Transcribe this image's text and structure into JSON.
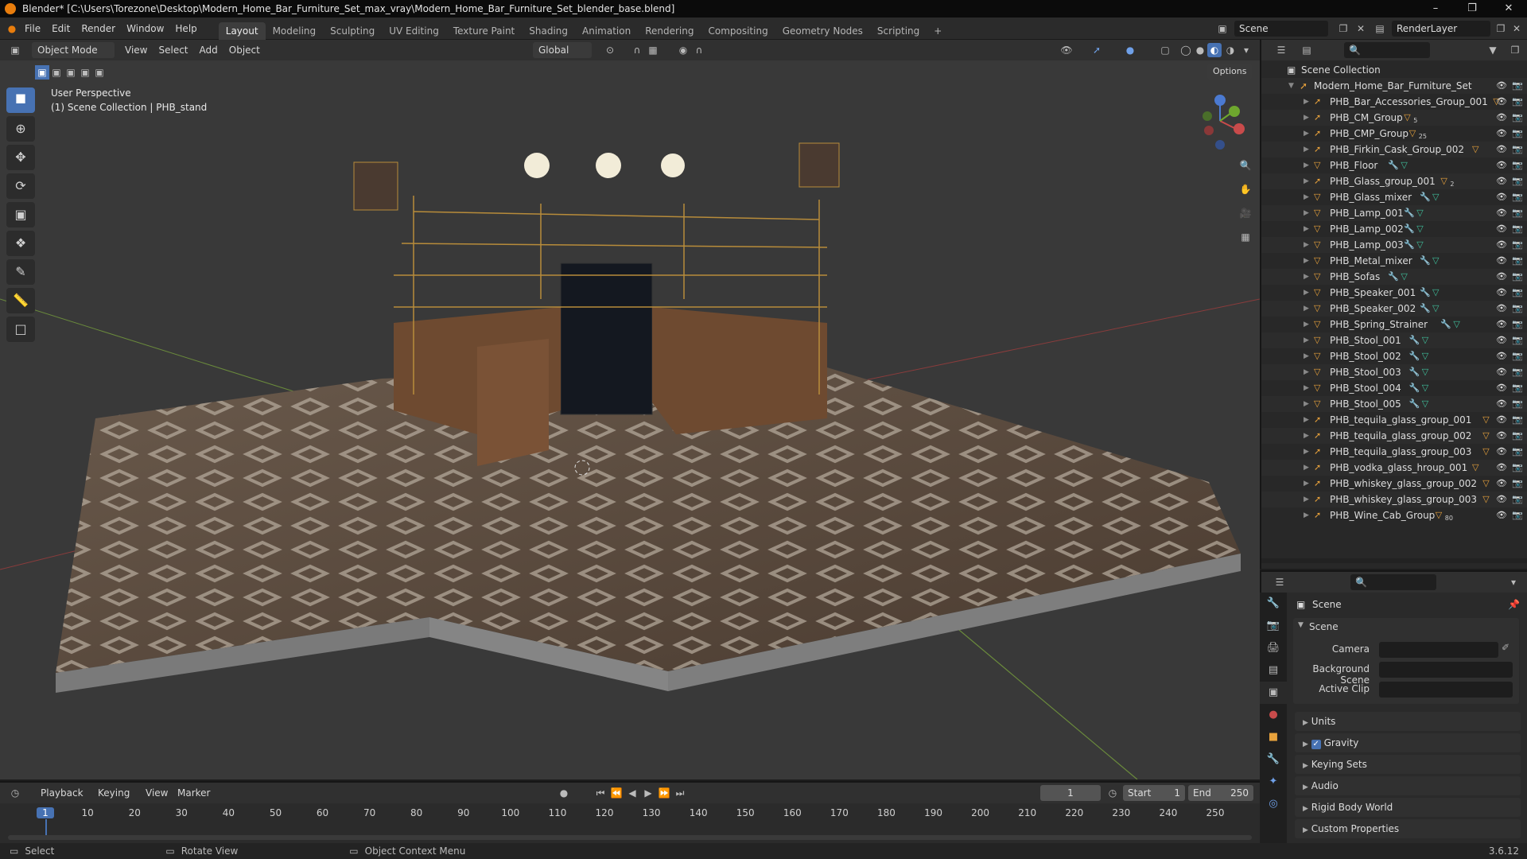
{
  "window": {
    "title": "Blender* [C:\\Users\\Torezone\\Desktop\\Modern_Home_Bar_Furniture_Set_max_vray\\Modern_Home_Bar_Furniture_Set_blender_base.blend]"
  },
  "menu": [
    "File",
    "Edit",
    "Render",
    "Window",
    "Help"
  ],
  "workspaces": [
    "Layout",
    "Modeling",
    "Sculpting",
    "UV Editing",
    "Texture Paint",
    "Shading",
    "Animation",
    "Rendering",
    "Compositing",
    "Geometry Nodes",
    "Scripting"
  ],
  "scene_name": "Scene",
  "renderlayer_name": "RenderLayer",
  "viewport_header": {
    "mode": "Object Mode",
    "view": "View",
    "select": "Select",
    "add": "Add",
    "object": "Object",
    "transform": "Global",
    "options": "Options"
  },
  "viewport": {
    "perspective": "User Perspective",
    "collection": "(1) Scene Collection | PHB_stand"
  },
  "outliner": {
    "root": "Scene Collection",
    "collection": "Modern_Home_Bar_Furniture_Set",
    "items": [
      {
        "name": "PHB_Bar_Accessories_Group_001",
        "type": "empty",
        "count": ""
      },
      {
        "name": "PHB_CM_Group",
        "type": "empty",
        "count": "5"
      },
      {
        "name": "PHB_CMP_Group",
        "type": "empty",
        "count": "25"
      },
      {
        "name": "PHB_Firkin_Cask_Group_002",
        "type": "empty",
        "count": ""
      },
      {
        "name": "PHB_Floor",
        "type": "mesh",
        "count": ""
      },
      {
        "name": "PHB_Glass_group_001",
        "type": "empty",
        "count": "2"
      },
      {
        "name": "PHB_Glass_mixer",
        "type": "mesh",
        "count": ""
      },
      {
        "name": "PHB_Lamp_001",
        "type": "mesh",
        "count": ""
      },
      {
        "name": "PHB_Lamp_002",
        "type": "mesh",
        "count": ""
      },
      {
        "name": "PHB_Lamp_003",
        "type": "mesh",
        "count": ""
      },
      {
        "name": "PHB_Metal_mixer",
        "type": "mesh",
        "count": ""
      },
      {
        "name": "PHB_Sofas",
        "type": "mesh",
        "count": ""
      },
      {
        "name": "PHB_Speaker_001",
        "type": "mesh",
        "count": ""
      },
      {
        "name": "PHB_Speaker_002",
        "type": "mesh",
        "count": ""
      },
      {
        "name": "PHB_Spring_Strainer",
        "type": "mesh",
        "count": ""
      },
      {
        "name": "PHB_Stool_001",
        "type": "mesh",
        "count": ""
      },
      {
        "name": "PHB_Stool_002",
        "type": "mesh",
        "count": ""
      },
      {
        "name": "PHB_Stool_003",
        "type": "mesh",
        "count": ""
      },
      {
        "name": "PHB_Stool_004",
        "type": "mesh",
        "count": ""
      },
      {
        "name": "PHB_Stool_005",
        "type": "mesh",
        "count": ""
      },
      {
        "name": "PHB_tequila_glass_group_001",
        "type": "empty",
        "count": ""
      },
      {
        "name": "PHB_tequila_glass_group_002",
        "type": "empty",
        "count": ""
      },
      {
        "name": "PHB_tequila_glass_group_003",
        "type": "empty",
        "count": ""
      },
      {
        "name": "PHB_vodka_glass_hroup_001",
        "type": "empty",
        "count": ""
      },
      {
        "name": "PHB_whiskey_glass_group_002",
        "type": "empty",
        "count": ""
      },
      {
        "name": "PHB_whiskey_glass_group_003",
        "type": "empty",
        "count": ""
      },
      {
        "name": "PHB_Wine_Cab_Group",
        "type": "empty",
        "count": "80"
      }
    ]
  },
  "properties": {
    "context": "Scene",
    "section": "Scene",
    "camera_label": "Camera",
    "bg_scene_label": "Background Scene",
    "active_clip_label": "Active Clip",
    "panels": [
      "Units",
      "Gravity",
      "Keying Sets",
      "Audio",
      "Rigid Body World",
      "Custom Properties"
    ]
  },
  "timeline": {
    "menus": [
      "Playback",
      "Keying",
      "View",
      "Marker"
    ],
    "current_frame": "1",
    "start_label": "Start",
    "start": "1",
    "end_label": "End",
    "end": "250",
    "ticks": [
      "1",
      "10",
      "20",
      "30",
      "40",
      "50",
      "60",
      "70",
      "80",
      "90",
      "100",
      "110",
      "120",
      "130",
      "140",
      "150",
      "160",
      "170",
      "180",
      "190",
      "200",
      "210",
      "220",
      "230",
      "240",
      "250"
    ]
  },
  "status": {
    "select": "Select",
    "rotate": "Rotate View",
    "context": "Object Context Menu",
    "version": "3.6.12"
  },
  "colors": {
    "accent": "#4772b3",
    "object_orange": "#e8a23c",
    "modifier_blue": "#6fa0e8",
    "mesh_green": "#3fbf9b",
    "frame_blue": "#4772b3"
  }
}
